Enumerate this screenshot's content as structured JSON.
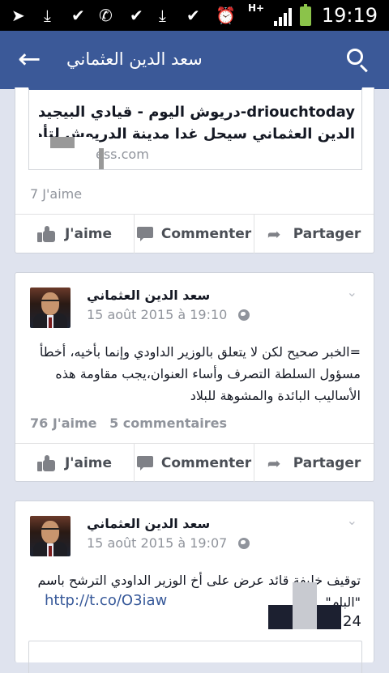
{
  "status_bar": {
    "time": "19:19",
    "network": "H+",
    "icons": [
      "nav-arrow-icon",
      "download-icon",
      "check-icon",
      "phone-icon",
      "check-icon",
      "download-icon",
      "check-icon",
      "alarm-icon",
      "signal-icon",
      "battery-charging-icon"
    ]
  },
  "app_bar": {
    "title": "سعد الدين العثماني",
    "back_icon": "arrow-back-icon",
    "search_icon": "search-icon",
    "color": "#3b5998"
  },
  "posts": [
    {
      "link_preview": {
        "title": "دريوش اليوم - قيادي البيجيدي سعد-الدين العثماني سيحل غدا مدينة الدريوش لتأطير...",
        "title_visible_start": "driouchtoday-",
        "line1": "دريوش اليوم - قيادي البيجيدي سعد-",
        "line2": "الدين العثماني سيحل غدا مدينة الدريوش لتأطير...",
        "domain": "ess.com"
      },
      "likes": "7 J'aime"
    },
    {
      "author": "سعد الدين العثماني",
      "timestamp": "15 août 2015 à 19:10",
      "text_lines": [
        "=الخبر صحيح لكن لا يتعلق بالوزير الداودي وإنما بأخيه، أخطأ",
        "مسؤول السلطة التصرف وأساء العنوان،يجب مقاومة هذه",
        "الأساليب البائدة والمشوهة للبلاد"
      ],
      "likes": "76 J'aime",
      "comments": "5 commentaires"
    },
    {
      "author": "سعد الدين العثماني",
      "timestamp": "15 août 2015 à 19:07",
      "text_lines": [
        "توقيف خليفة قائد عرض على أخ الوزير الداودي الترشح باسم",
        "\"البام\""
      ],
      "link": "http://t.co/O3iaw",
      "tail": "24"
    }
  ],
  "actions": {
    "like": "J'aime",
    "comment": "Commenter",
    "share": "Partager"
  }
}
